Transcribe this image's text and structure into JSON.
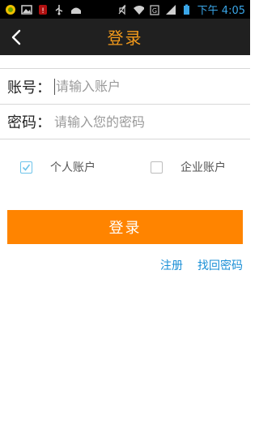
{
  "status_bar": {
    "left_icons": [
      "signal-app-icon",
      "image-icon",
      "notification-icon",
      "usb-icon",
      "android-icon"
    ],
    "right_icons": [
      "mute-icon",
      "wifi-icon",
      "mobile-signal-icon",
      "signal-bars-icon",
      "battery-icon"
    ],
    "time": "下午 4:05"
  },
  "header": {
    "title": "登录"
  },
  "form": {
    "account_label": "账号：",
    "account_placeholder": "请输入账户",
    "password_label": "密码：",
    "password_placeholder": "请输入您的密码"
  },
  "account_type": {
    "personal_label": "个人账户",
    "personal_checked": true,
    "company_label": "企业账户",
    "company_checked": false
  },
  "actions": {
    "login_label": "登录",
    "register_label": "注册",
    "recover_label": "找回密码"
  },
  "colors": {
    "title": "#f39a1b",
    "login_button": "#ff8400",
    "link": "#1a8fd6",
    "checkbox_checked": "#6ec4ea"
  }
}
